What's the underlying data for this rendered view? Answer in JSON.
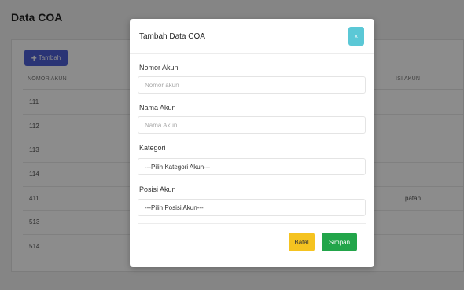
{
  "page": {
    "title": "Data COA",
    "add_button": "Tambah",
    "table": {
      "headers": [
        "NOMOR AKUN",
        "ISI AKUN"
      ],
      "rows": [
        {
          "number": "111",
          "right": ""
        },
        {
          "number": "112",
          "right": ""
        },
        {
          "number": "113",
          "right": ""
        },
        {
          "number": "114",
          "right": ""
        },
        {
          "number": "411",
          "right": "patan"
        },
        {
          "number": "513",
          "right": ""
        },
        {
          "number": "514",
          "right": ""
        }
      ]
    }
  },
  "modal": {
    "title": "Tambah Data COA",
    "close_label": "x",
    "fields": {
      "nomor_akun": {
        "label": "Nomor Akun",
        "placeholder": "Nomor akun"
      },
      "nama_akun": {
        "label": "Nama Akun",
        "placeholder": "Nama Akun"
      },
      "kategori": {
        "label": "Kategori",
        "value": "---Pilih Kategori Akun---"
      },
      "posisi_akun": {
        "label": "Posisi Akun",
        "value": "---Pilih Posisi Akun---"
      }
    },
    "cancel_label": "Batal",
    "save_label": "Simpan"
  },
  "colors": {
    "primary": "#4e5fd6",
    "info": "#5bc8d6",
    "warning": "#f5c320",
    "success": "#22a54a"
  }
}
